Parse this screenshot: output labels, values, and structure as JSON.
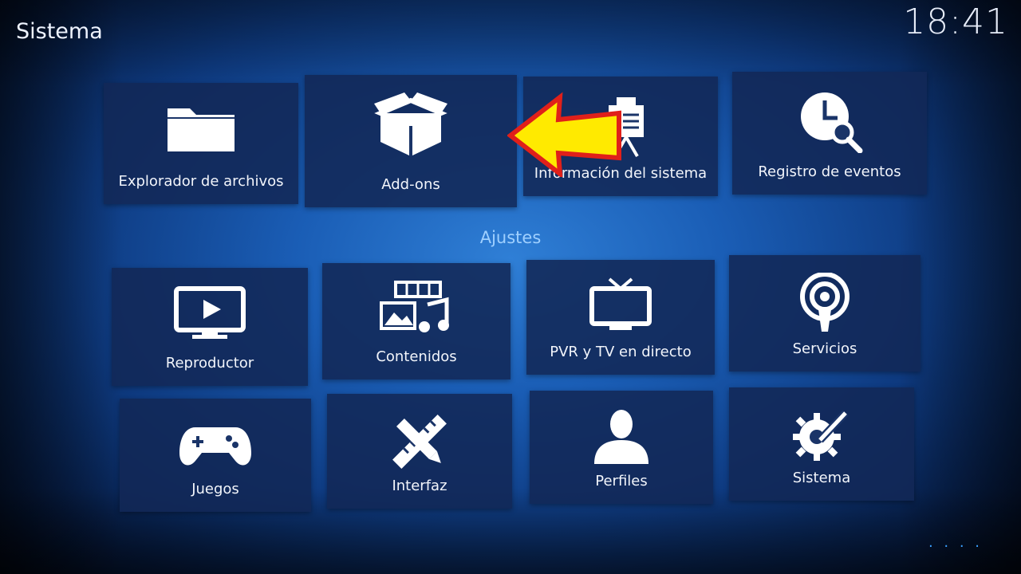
{
  "header": {
    "title": "Sistema",
    "clock": "18:41"
  },
  "top_row": [
    {
      "label": "Explorador de archivos",
      "icon": "folder-icon"
    },
    {
      "label": "Add-ons",
      "icon": "box-icon"
    },
    {
      "label": "Información del sistema",
      "icon": "presentation-board-icon"
    },
    {
      "label": "Registro de eventos",
      "icon": "clock-search-icon"
    }
  ],
  "section": {
    "label": "Ajustes"
  },
  "settings": [
    {
      "label": "Reproductor",
      "icon": "play-monitor-icon"
    },
    {
      "label": "Contenidos",
      "icon": "media-library-icon"
    },
    {
      "label": "PVR y TV en directo",
      "icon": "tv-icon"
    },
    {
      "label": "Servicios",
      "icon": "broadcast-icon"
    },
    {
      "label": "Juegos",
      "icon": "gamepad-icon"
    },
    {
      "label": "Interfaz",
      "icon": "pencil-ruler-icon"
    },
    {
      "label": "Perfiles",
      "icon": "person-icon"
    },
    {
      "label": "Sistema",
      "icon": "gear-wrench-icon"
    }
  ],
  "overlay": {
    "arrow_color": "#ffea00",
    "arrow_outline": "#e0201a"
  },
  "footer": {
    "page_dots": "· · · ·"
  }
}
